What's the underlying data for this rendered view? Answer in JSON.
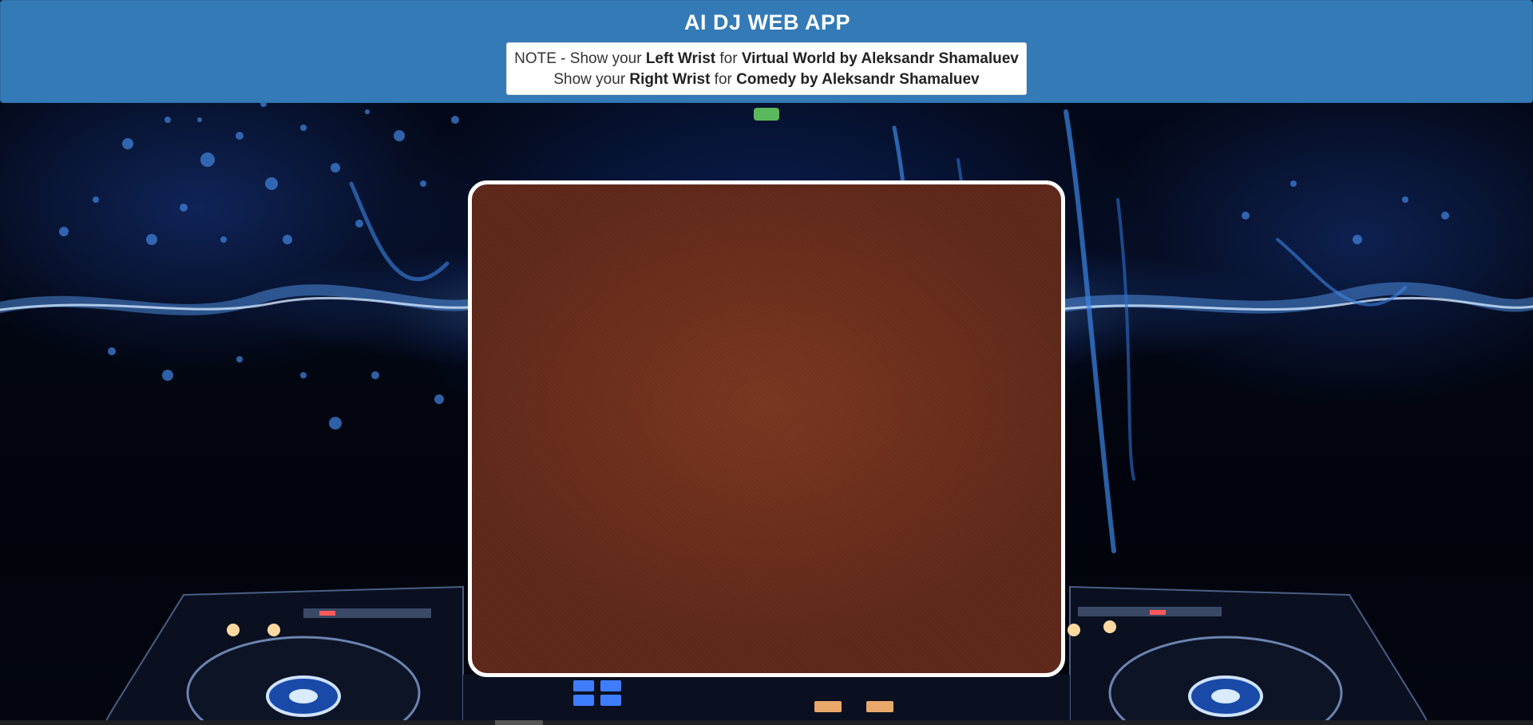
{
  "app": {
    "title": "AI DJ WEB APP"
  },
  "note": {
    "line1": {
      "prefix": "NOTE - Show your ",
      "trigger": "Left Wrist",
      "connector": " for ",
      "song": "Virtual World by Aleksandr Shamaluev"
    },
    "line2": {
      "prefix": "Show your ",
      "trigger": "Right Wrist",
      "connector": " for ",
      "song": "Comedy by Aleksandr Shamaluev"
    }
  },
  "status": {
    "indicator_color": "#5cb85c"
  },
  "video": {
    "frame_color": "#ffffff",
    "feed_color": "#6e301d"
  },
  "theme": {
    "header_bg": "#337ab7",
    "background": "dj-turntables-with-blue-sound-wave"
  }
}
